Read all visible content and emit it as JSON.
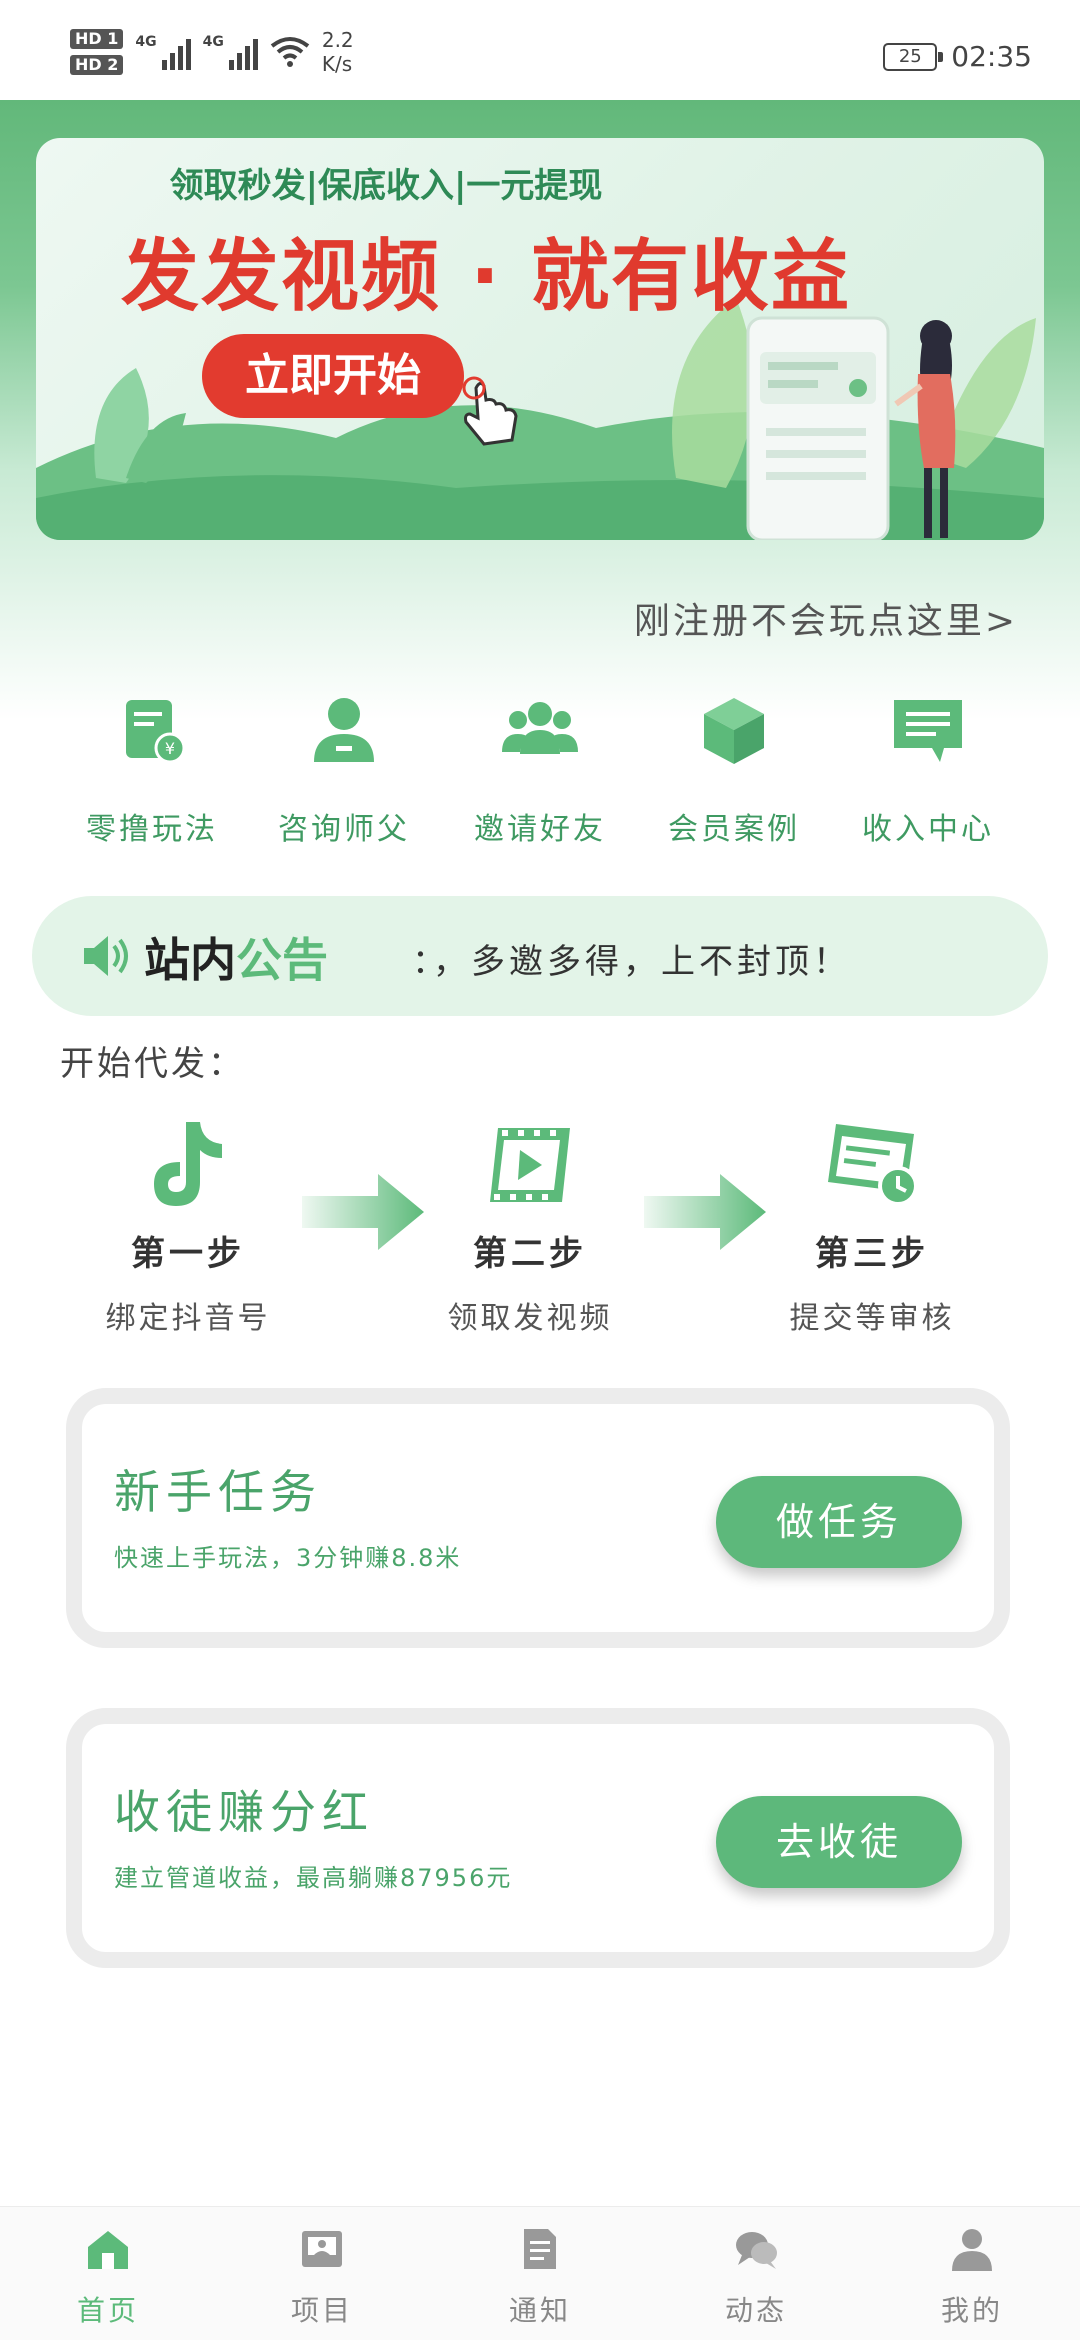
{
  "status_bar": {
    "hd1": "HD 1",
    "hd2": "HD 2",
    "net1": "4G",
    "net2": "4G",
    "speed_value": "2.2",
    "speed_unit": "K/s",
    "battery": "25",
    "time": "02:35"
  },
  "banner": {
    "subtitle": "领取秒发|保底收入|一元提现",
    "title": "发发视频 · 就有收益",
    "cta": "立即开始"
  },
  "newbie_link": "刚注册不会玩点这里>",
  "shortcuts": [
    {
      "label": "零撸玩法",
      "icon": "receipt-yen-icon"
    },
    {
      "label": "咨询师父",
      "icon": "user-icon"
    },
    {
      "label": "邀请好友",
      "icon": "group-icon"
    },
    {
      "label": "会员案例",
      "icon": "cube-icon"
    },
    {
      "label": "收入中心",
      "icon": "message-icon"
    }
  ],
  "notice": {
    "title_dark": "站内",
    "title_green": "公告",
    "text": "：，多邀多得，上不封顶！"
  },
  "start_label": "开始代发：",
  "steps": [
    {
      "title": "第一步",
      "desc": "绑定抖音号",
      "icon": "tiktok-icon"
    },
    {
      "title": "第二步",
      "desc": "领取发视频",
      "icon": "video-icon"
    },
    {
      "title": "第三步",
      "desc": "提交等审核",
      "icon": "form-clock-icon"
    }
  ],
  "cards": [
    {
      "title": "新手任务",
      "desc": "快速上手玩法，3分钟赚8.8米",
      "button": "做任务"
    },
    {
      "title": "收徒赚分红",
      "desc": "建立管道收益，最高躺赚87956元",
      "button": "去收徒"
    }
  ],
  "nav": [
    {
      "label": "首页",
      "icon": "home-icon",
      "active": true
    },
    {
      "label": "项目",
      "icon": "project-icon",
      "active": false
    },
    {
      "label": "通知",
      "icon": "document-icon",
      "active": false
    },
    {
      "label": "动态",
      "icon": "chat-icon",
      "active": false
    },
    {
      "label": "我的",
      "icon": "profile-icon",
      "active": false
    }
  ],
  "colors": {
    "primary_green": "#5cba7a",
    "accent_red": "#e03a2e"
  }
}
